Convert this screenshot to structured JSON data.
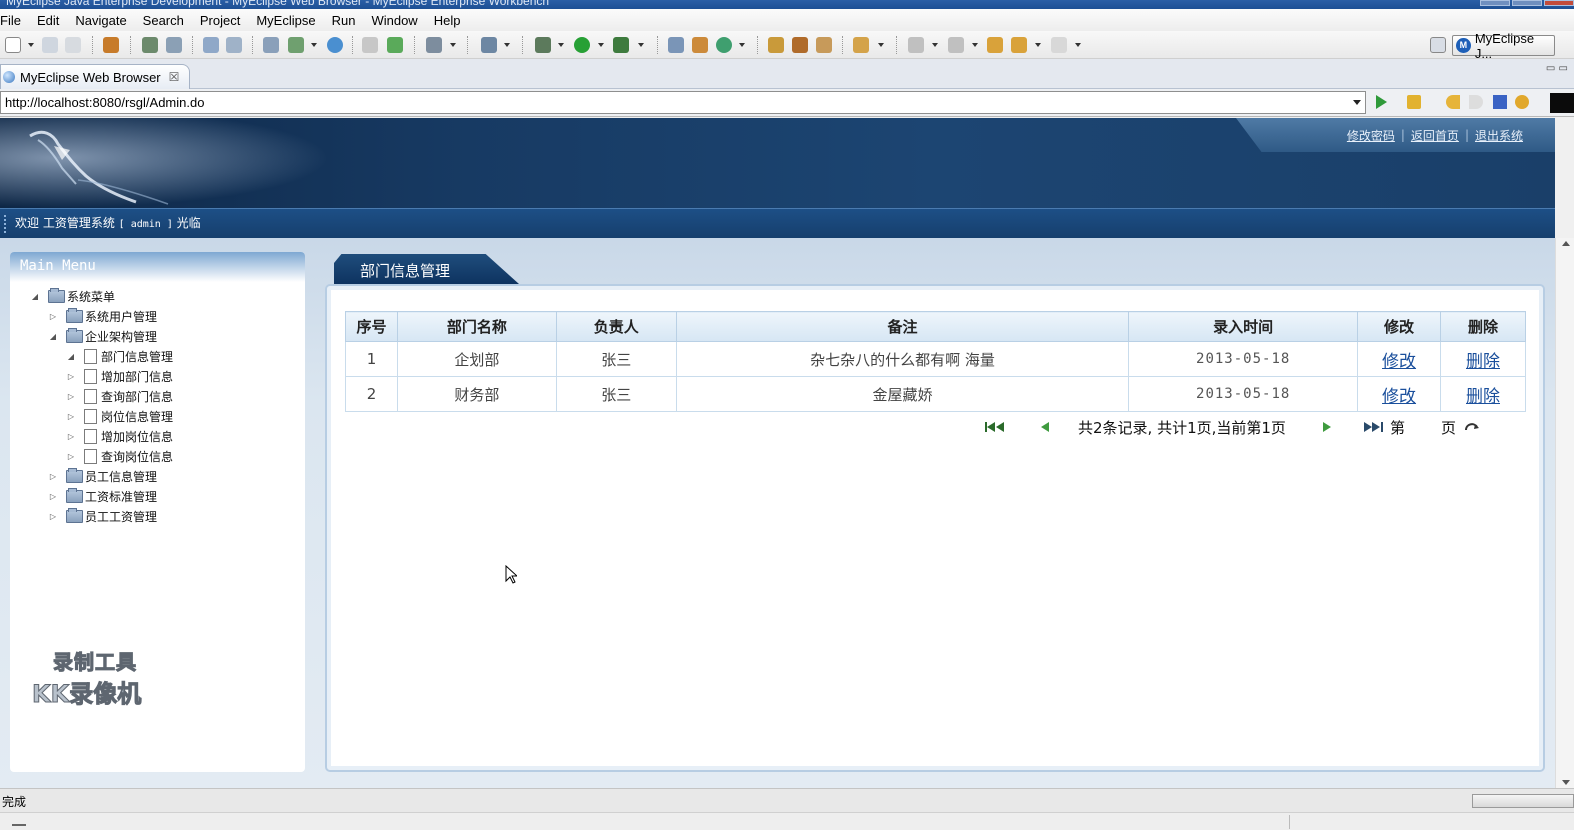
{
  "window": {
    "title": "MyEclipse Java Enterprise Development - MyEclipse Web Browser - MyEclipse Enterprise Workbench"
  },
  "menubar": {
    "items": [
      "File",
      "Edit",
      "Navigate",
      "Search",
      "Project",
      "MyEclipse",
      "Run",
      "Window",
      "Help"
    ]
  },
  "toolbar": {
    "perspective_label": "MyEclipse J..."
  },
  "editor_tab": {
    "label": "MyEclipse Web Browser",
    "close": "☒"
  },
  "browser": {
    "url": "http://localhost:8080/rsgl/Admin.do"
  },
  "page": {
    "top_links": [
      "修改密码",
      "返回首页",
      "退出系统"
    ],
    "welcome": {
      "prefix": "欢迎 工资管理系统",
      "user": "[ admin ]",
      "suffix": "光临"
    },
    "sidebar": {
      "title": "Main Menu",
      "tree": {
        "root": "系统菜单",
        "system_users": "系统用户管理",
        "org": "企业架构管理",
        "org_children": [
          "部门信息管理",
          "增加部门信息",
          "查询部门信息",
          "岗位信息管理",
          "增加岗位信息",
          "查询岗位信息"
        ],
        "employee": "员工信息管理",
        "salary_std": "工资标准管理",
        "salary": "员工工资管理"
      },
      "watermark": {
        "line1": "录制工具",
        "line2": "KK录像机"
      }
    },
    "main": {
      "tab_title": "部门信息管理",
      "table": {
        "headers": [
          "序号",
          "部门名称",
          "负责人",
          "备注",
          "录入时间",
          "修改",
          "删除"
        ],
        "rows": [
          {
            "no": "1",
            "name": "企划部",
            "manager": "张三",
            "note": "杂七杂八的什么都有啊 海量",
            "date": "2013-05-18",
            "edit": "修改",
            "delete": "删除"
          },
          {
            "no": "2",
            "name": "财务部",
            "manager": "张三",
            "note": "金屋藏娇",
            "date": "2013-05-18",
            "edit": "修改",
            "delete": "删除"
          }
        ]
      },
      "pager": {
        "summary": "共2条记录,  共计1页,当前第1页",
        "goto_prefix": "第",
        "goto_suffix": "页"
      }
    }
  },
  "status": {
    "text": "完成"
  },
  "colors": {
    "banner": "#173a63",
    "link": "#1a4f9c",
    "table_header": "#d6e6f4"
  }
}
